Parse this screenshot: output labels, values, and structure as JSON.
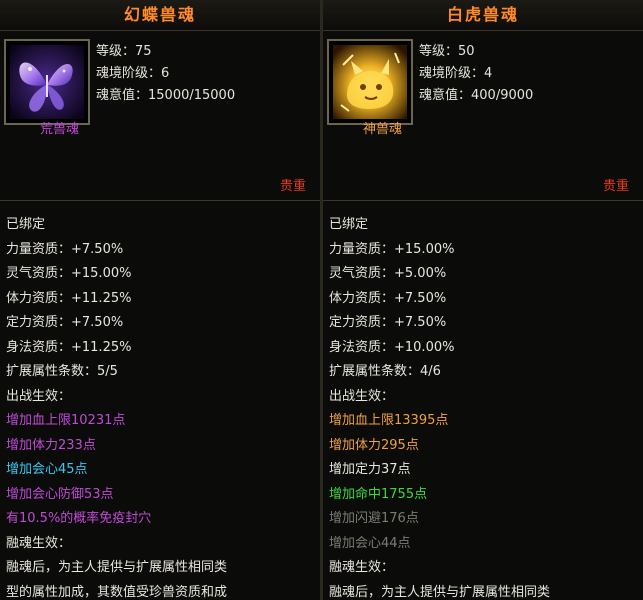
{
  "colors": {
    "title": "#ff8a2a",
    "white": "#e8e6dc",
    "purple": "#c04ad8",
    "orange": "#f0a040",
    "cyan": "#3cc8f0",
    "green": "#3adc3a",
    "gray": "#7b7b72",
    "red": "#e23b1c"
  },
  "left": {
    "title": "幻蝶兽魂",
    "icon": "butterfly-icon",
    "level_text": "等级：75",
    "realm_text": "魂境阶级：6",
    "soul_value_text": "魂意值：15000/15000",
    "type_label": "荒兽魂",
    "type_color": "#c04ad8",
    "rank": "贵重",
    "bound": "已绑定",
    "attributes": [
      "力量资质：+7.50%",
      "灵气资质：+15.00%",
      "体力资质：+11.25%",
      "定力资质：+7.50%",
      "身法资质：+11.25%"
    ],
    "ext_attr_count": "扩展属性条数：5/5",
    "battle_header": "出战生效：",
    "battle_effects": [
      {
        "text": "增加血上限10231点",
        "color": "#c04ad8"
      },
      {
        "text": "增加体力233点",
        "color": "#c04ad8"
      },
      {
        "text": "增加会心45点",
        "color": "#3cc8f0"
      },
      {
        "text": "增加会心防御53点",
        "color": "#c04ad8"
      },
      {
        "text": "有10.5%的概率免疫封穴",
        "color": "#c04ad8"
      }
    ],
    "fusion_header": "融魂生效：",
    "fusion_lines": [
      "融魂后，为主人提供与扩展属性相同类",
      "型的属性加成，其数值受珍兽资质和成"
    ]
  },
  "right": {
    "title": "白虎兽魂",
    "icon": "white-tiger-icon",
    "level_text": "等级：50",
    "realm_text": "魂境阶级：4",
    "soul_value_text": "魂意值：400/9000",
    "type_label": "神兽魂",
    "type_color": "#f0a040",
    "rank": "贵重",
    "bound": "已绑定",
    "attributes": [
      "力量资质：+15.00%",
      "灵气资质：+5.00%",
      "体力资质：+7.50%",
      "定力资质：+7.50%",
      "身法资质：+10.00%"
    ],
    "ext_attr_count": "扩展属性条数：4/6",
    "battle_header": "出战生效：",
    "battle_effects": [
      {
        "text": "增加血上限13395点",
        "color": "#f0a040"
      },
      {
        "text": "增加体力295点",
        "color": "#f0a040"
      },
      {
        "text": "增加定力37点",
        "color": "#e8e6dc"
      },
      {
        "text": "增加命中1755点",
        "color": "#3adc3a"
      },
      {
        "text": "增加闪避176点",
        "color": "#7b7b72"
      },
      {
        "text": "增加会心44点",
        "color": "#7b7b72"
      }
    ],
    "fusion_header": "融魂生效：",
    "fusion_lines": [
      "融魂后，为主人提供与扩展属性相同类"
    ]
  }
}
